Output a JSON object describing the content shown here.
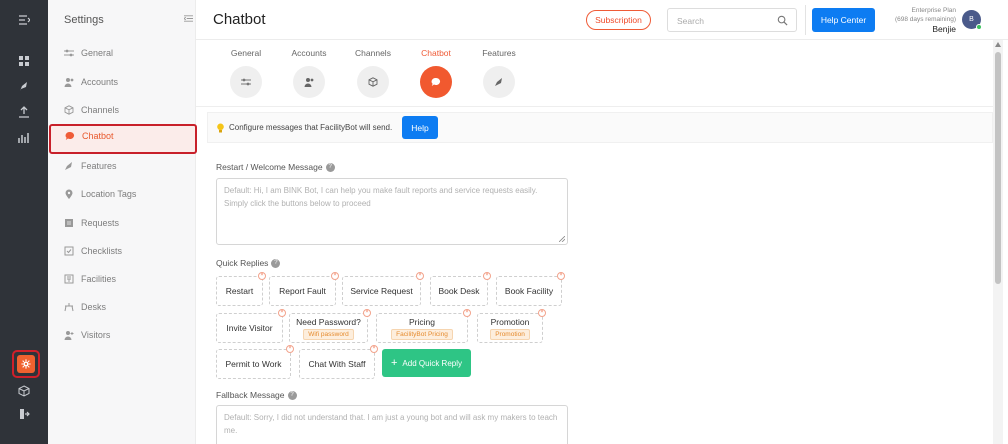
{
  "rail": {
    "icons": [
      "menu-icon",
      "dashboard-icon",
      "rocket-icon",
      "upload-icon",
      "analytics-icon",
      "settings-icon",
      "box-icon",
      "logout-icon"
    ]
  },
  "sidebar": {
    "title": "Settings",
    "items": [
      {
        "label": "General",
        "icon": "sliders-icon"
      },
      {
        "label": "Accounts",
        "icon": "users-icon"
      },
      {
        "label": "Channels",
        "icon": "cube-icon"
      },
      {
        "label": "Chatbot",
        "icon": "chat-icon"
      },
      {
        "label": "Features",
        "icon": "rocket-icon"
      },
      {
        "label": "Location Tags",
        "icon": "map-pin-icon"
      },
      {
        "label": "Requests",
        "icon": "clipboard-icon"
      },
      {
        "label": "Checklists",
        "icon": "checklist-icon"
      },
      {
        "label": "Facilities",
        "icon": "facility-icon"
      },
      {
        "label": "Desks",
        "icon": "desk-icon"
      },
      {
        "label": "Visitors",
        "icon": "visitors-icon"
      }
    ]
  },
  "header": {
    "title": "Chatbot",
    "subscription_label": "Subscription",
    "search_placeholder": "Search",
    "help_center_label": "Help Center",
    "plan_name": "Enterprise Plan",
    "plan_remaining": "(698 days remaining)",
    "user_name": "Benjie",
    "avatar_initial": "B"
  },
  "tabs": [
    {
      "label": "General",
      "icon": "sliders-icon"
    },
    {
      "label": "Accounts",
      "icon": "users-icon"
    },
    {
      "label": "Channels",
      "icon": "cube-icon"
    },
    {
      "label": "Chatbot",
      "icon": "chat-icon"
    },
    {
      "label": "Features",
      "icon": "rocket-icon"
    }
  ],
  "info": {
    "text": "Configure messages that FacilityBot will send.",
    "help_label": "Help"
  },
  "welcome": {
    "label": "Restart / Welcome Message",
    "placeholder": "Default: Hi, I am BINK Bot, I can help you make fault reports and service requests easily. Simply click the buttons below to proceed"
  },
  "quick_replies": {
    "label": "Quick Replies",
    "items": [
      {
        "label": "Restart"
      },
      {
        "label": "Report Fault"
      },
      {
        "label": "Service Request"
      },
      {
        "label": "Book Desk"
      },
      {
        "label": "Book Facility"
      },
      {
        "label": "Invite Visitor"
      },
      {
        "label": "Need Password?",
        "tag": "Wifi password"
      },
      {
        "label": "Pricing",
        "tag": "FacilityBot Pricing"
      },
      {
        "label": "Promotion",
        "tag": "Promotion"
      },
      {
        "label": "Permit to Work"
      },
      {
        "label": "Chat With Staff"
      }
    ],
    "add_label": "Add Quick Reply"
  },
  "fallback": {
    "label": "Fallback Message",
    "placeholder": "Default: Sorry, I did not understand that. I am just a young bot and will ask my makers to teach me."
  },
  "colors": {
    "accent": "#f1592f",
    "primary_blue": "#0d7cf2",
    "green": "#2ec585",
    "rail_bg": "#2f3339",
    "highlight_border": "#c8202a"
  }
}
